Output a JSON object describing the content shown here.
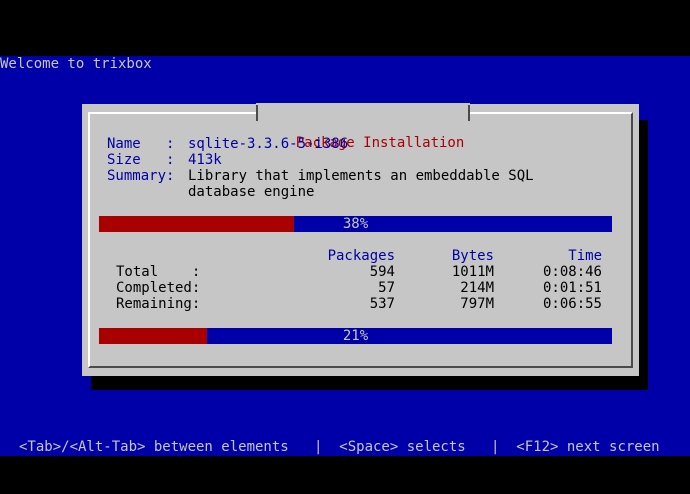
{
  "screen": {
    "welcome_text": "Welcome to trixbox",
    "hint_text": "<Tab>/<Alt-Tab> between elements   |  <Space> selects   |  <F12> next screen"
  },
  "dialog": {
    "title": "Package Installation",
    "package": {
      "name_label": "Name   :",
      "name_value": "sqlite-3.3.6-5-i386",
      "size_label": "Size   :",
      "size_value": "413k",
      "summary_label": "Summary:",
      "summary_line1": "Library that implements an embeddable SQL",
      "summary_line2": "database engine"
    },
    "package_progress": {
      "percent": 38,
      "label": "38%"
    },
    "stats": {
      "headers": {
        "packages": "Packages",
        "bytes": "Bytes",
        "time": "Time"
      },
      "rows": [
        {
          "label": "Total    :",
          "packages": "594",
          "bytes": "1011M",
          "time": "0:08:46"
        },
        {
          "label": "Completed:",
          "packages": "57",
          "bytes": "214M",
          "time": "0:01:51"
        },
        {
          "label": "Remaining:",
          "packages": "537",
          "bytes": "797M",
          "time": "0:06:55"
        }
      ]
    },
    "total_progress": {
      "percent": 21,
      "label": "21%"
    }
  },
  "colors": {
    "screen_bg": "#0000a8",
    "dialog_bg": "#c6c6c6",
    "title_text": "#a80000",
    "label_text": "#0000a8",
    "progress_fill": "#a80000",
    "progress_track": "#0000a8"
  }
}
